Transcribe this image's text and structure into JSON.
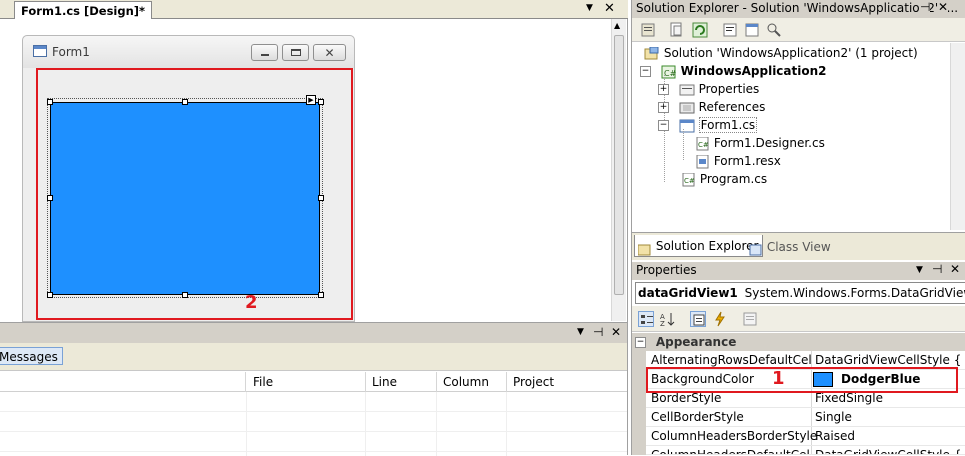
{
  "designer": {
    "tab_label": "Form1.cs [Design]*",
    "form_title": "Form1",
    "grid_color": "#1E90FF",
    "annotation_number": "2"
  },
  "solution_explorer": {
    "title": "Solution Explorer - Solution 'WindowsApplication2' (...",
    "solution_label": "Solution 'WindowsApplication2' (1 project)",
    "project_label": "WindowsApplication2",
    "nodes": {
      "properties": "Properties",
      "references": "References",
      "form1": "Form1.cs",
      "designer": "Form1.Designer.cs",
      "resx": "Form1.resx",
      "program": "Program.cs"
    },
    "tab_solution": "Solution Explorer",
    "tab_class": "Class View"
  },
  "properties": {
    "title": "Properties",
    "object_name": "dataGridView1",
    "object_type": "System.Windows.Forms.DataGridView",
    "category": "Appearance",
    "rows": [
      {
        "name": "AlternatingRowsDefaultCellSty",
        "value": "DataGridViewCellStyle { }"
      },
      {
        "name": "BackgroundColor",
        "value": "DodgerBlue"
      },
      {
        "name": "BorderStyle",
        "value": "FixedSingle"
      },
      {
        "name": "CellBorderStyle",
        "value": "Single"
      },
      {
        "name": "ColumnHeadersBorderStyle",
        "value": "Raised"
      },
      {
        "name": "ColumnHeadersDefaultCellSty",
        "value": "DataGridViewCellStyle { BackColor"
      }
    ],
    "annotation_number": "1",
    "swatch_color": "#1E90FF"
  },
  "error_list": {
    "messages_tab": "Messages",
    "columns": [
      "File",
      "Line",
      "Column",
      "Project"
    ]
  },
  "colors": {
    "annotation_red": "#E0191F",
    "chrome": "#D4D0C8"
  }
}
